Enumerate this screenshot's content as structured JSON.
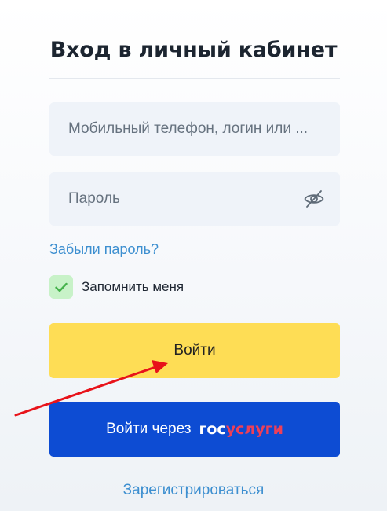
{
  "page": {
    "title": "Вход в личный кабинет"
  },
  "form": {
    "login_placeholder": "Мобильный телефон, логин или ...",
    "login_value": "",
    "password_placeholder": "Пароль",
    "password_value": "",
    "password_toggle_icon": "eye-slash-icon",
    "forgot_password": "Забыли пароль?",
    "remember_me": "Запомнить меня",
    "remember_checked": true,
    "checkbox_icon": "check-icon"
  },
  "buttons": {
    "login_label": "Войти",
    "gosuslugi_prefix": "Войти через",
    "gosuslugi_logo_part1": "гос",
    "gosuslugi_logo_part2": "услуги"
  },
  "register_link": "Зарегистрироваться",
  "annotation": {
    "icon": "arrow-icon",
    "color": "#e8131a",
    "points_to": "login-button"
  },
  "colors": {
    "login_button": "#fedd55",
    "gosuslugi_button": "#0d4cd3",
    "link": "#3d8fd0",
    "checkbox_bg": "#c8f2c8",
    "checkbox_mark": "#45b24b",
    "logo_accent": "#ee3f58"
  }
}
